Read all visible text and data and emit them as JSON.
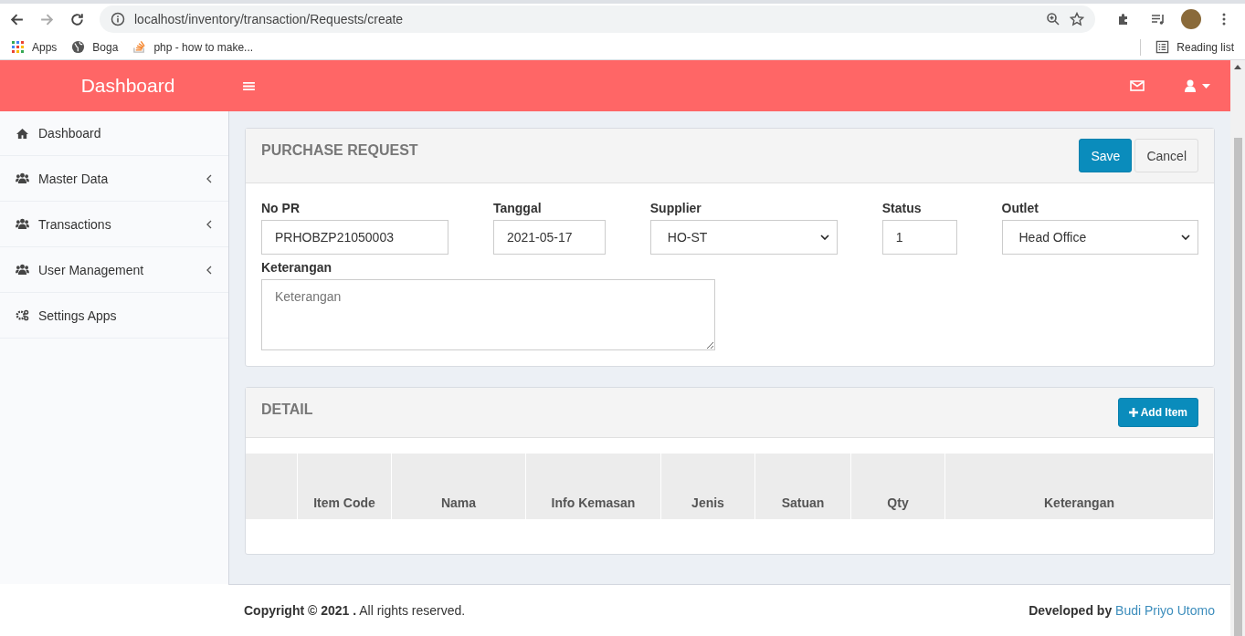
{
  "browser": {
    "url": "localhost/inventory/transaction/Requests/create",
    "back_disabled": false,
    "forward_disabled": true,
    "bookmarks": [
      {
        "label": "Apps"
      },
      {
        "label": "Boga"
      },
      {
        "label": "php - how to make..."
      }
    ],
    "reading_list": "Reading list"
  },
  "header": {
    "brand": "Dashboard"
  },
  "sidebar": {
    "items": [
      {
        "label": "Dashboard",
        "has_submenu": false
      },
      {
        "label": "Master Data",
        "has_submenu": true
      },
      {
        "label": "Transactions",
        "has_submenu": true
      },
      {
        "label": "User Management",
        "has_submenu": true
      },
      {
        "label": "Settings Apps",
        "has_submenu": false
      }
    ]
  },
  "form": {
    "title": "PURCHASE REQUEST",
    "buttons": [
      {
        "label": "Save",
        "kind": "primary"
      },
      {
        "label": "Cancel",
        "kind": "default"
      }
    ],
    "fields": [
      {
        "label": "No PR",
        "kind": "text",
        "value": "PRHOBZP21050003"
      },
      {
        "label": "Tanggal",
        "kind": "text",
        "value": "2021-05-17"
      },
      {
        "label": "Supplier",
        "kind": "select",
        "value": "HO-ST"
      },
      {
        "label": "Status",
        "kind": "text",
        "value": "1"
      },
      {
        "label": "Outlet",
        "kind": "select",
        "value": "Head Office"
      }
    ],
    "notes": {
      "label": "Keterangan",
      "placeholder": "Keterangan"
    }
  },
  "detail": {
    "title": "DETAIL",
    "add_button": "Add Item",
    "columns": [
      "Item Code",
      "Nama",
      "Info Kemasan",
      "Jenis",
      "Satuan",
      "Qty",
      "Keterangan"
    ]
  },
  "footer": {
    "copyright": "**Copyright © 2021 .** All rights reserved.",
    "developed_by": "Developed by",
    "author": "Budi Priyo Utomo"
  }
}
